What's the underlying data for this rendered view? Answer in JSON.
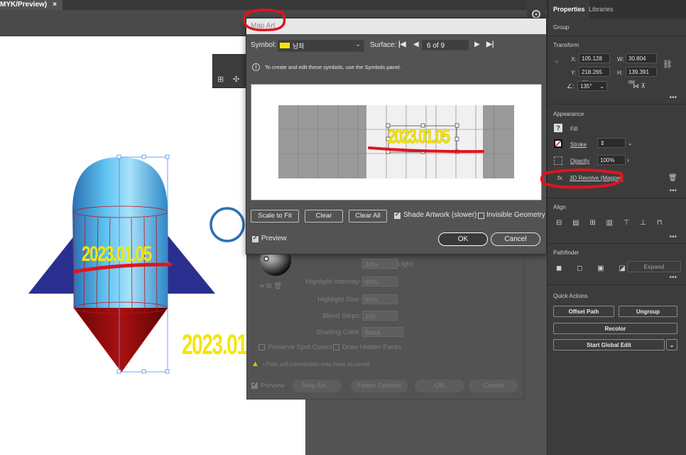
{
  "document": {
    "tab_label": "MYK/Preview)",
    "tab_close": "×"
  },
  "artwork": {
    "date_label": "2023.01.05",
    "date_label_outside": "2023.01."
  },
  "map_art": {
    "title": "Map Art",
    "symbol_label": "Symbol:",
    "symbol_value": "남좌",
    "surface_label": "Surface:",
    "surface_value": "6 of 9",
    "info_text": "To create and edit these symbols, use the Symbols panel.",
    "preview_date": "2023.01.05",
    "scale_to_fit": "Scale to Fit",
    "clear": "Clear",
    "clear_all": "Clear All",
    "shade_artwork": "Shade Artwork (slower)",
    "shade_artwork_checked": true,
    "invisible_geometry": "Invisible Geometry",
    "invisible_geometry_checked": false,
    "preview": "Preview",
    "preview_checked": true,
    "ok": "OK",
    "cancel": "Cancel"
  },
  "revolve_dialog": {
    "ambient_light_label": "Ambient Light:",
    "ambient_light_value": "24%",
    "highlight_intensity_label": "Highlight Intensity:",
    "highlight_intensity_value": "60%",
    "highlight_size_label": "Highlight Size:",
    "highlight_size_value": "90%",
    "blend_steps_label": "Blend Steps:",
    "blend_steps_value": "100",
    "shading_color_label": "Shading Color:",
    "shading_color_value": "Black",
    "preserve_spot": "Preserve Spot Colors",
    "draw_hidden": "Draw Hidden Faces",
    "warning": "• Path self-intersection may have occurred.",
    "preview": "Preview",
    "map_art": "Map Art...",
    "fewer_options": "Fewer Options",
    "ok": "OK",
    "cancel": "Cancel"
  },
  "properties": {
    "tab_properties": "Properties",
    "tab_libraries": "Libraries",
    "group": "Group",
    "transform": "Transform",
    "x_label": "X:",
    "x_value": "105.128 mr",
    "y_label": "Y:",
    "y_value": "218.265 mr",
    "w_label": "W:",
    "w_value": "30.804 mm",
    "h_label": "H:",
    "h_value": "139.391 mr",
    "angle_value": "135°",
    "appearance": "Appearance",
    "fill": "Fill",
    "stroke": "Stroke",
    "opacity": "Opacity",
    "opacity_value": "100%",
    "effect": "3D Revolve (Mapped",
    "fx": "fx.",
    "align": "Align",
    "pathfinder": "Pathfinder",
    "expand": "Expand",
    "quick_actions": "Quick Actions",
    "offset_path": "Offset Path",
    "ungroup": "Ungroup",
    "recolor": "Recolor",
    "start_global_edit": "Start Global Edit",
    "more": "•••"
  },
  "colors": {
    "accent_yellow": "#f5e600",
    "annotation_red": "#e0141e",
    "rocket_blue": "#3aa7e0",
    "fin_navy": "#2a2f8f",
    "cone_red": "#8a0a0a"
  }
}
